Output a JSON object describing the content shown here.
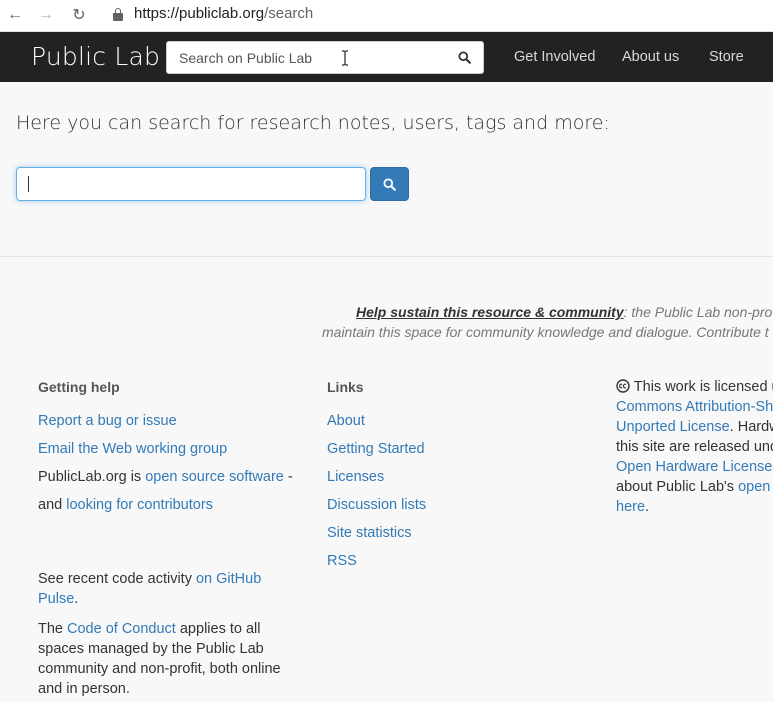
{
  "browser": {
    "url_host": "https://publiclab.org",
    "url_path": "/search",
    "back_icon": "←",
    "forward_icon": "→",
    "reload_icon": "↻"
  },
  "navbar": {
    "brand": "Public Lab",
    "search_placeholder": "Search on Public Lab",
    "links": [
      "Get Involved",
      "About us",
      "Store"
    ]
  },
  "main": {
    "intro": "Here you can search for research notes, users, tags and more:",
    "search_value": ""
  },
  "footer": {
    "sustain_link": "Help sustain this resource & community",
    "sustain_rest": ": the Public Lab non-pro",
    "sustain_line2": "maintain this space for community knowledge and dialogue. Contribute t",
    "getting_help": {
      "title": "Getting help",
      "report_bug": "Report a bug or issue",
      "email_group": "Email the Web working group",
      "oss_prefix": "PublicLab.org is ",
      "oss_link": "open source software",
      "oss_suffix": " -",
      "and_text": "and ",
      "contributors_link": "looking for contributors",
      "recent_prefix": "See recent code activity ",
      "github_link_1": "on GitHub",
      "github_link_2": "Pulse",
      "github_suffix": ".",
      "the_text": "The ",
      "coc_link": "Code of Conduct",
      "coc_rest_1": " applies to all",
      "coc_rest_2": "spaces managed by the Public Lab",
      "coc_rest_3": "community and non-profit, both online",
      "coc_rest_4": "and in person."
    },
    "links": {
      "title": "Links",
      "items": [
        "About",
        "Getting Started",
        "Licenses",
        "Discussion lists",
        "Site statistics",
        "RSS"
      ]
    },
    "license": {
      "cc_icon": "🅭",
      "line1": " This work is licensed u",
      "link1": "Commons Attribution-Sha",
      "link2": "Unported License",
      "line3_rest": ". Hardw",
      "line4": "this site are released und",
      "link3": "Open Hardware License",
      "line5_rest": " ",
      "line6": "about Public Lab's ",
      "link4": "open",
      "link5": "here",
      "end": "."
    }
  },
  "colors": {
    "navbar_bg": "#222222",
    "link": "#337ab7",
    "button_primary": "#337ab7",
    "page_bg": "#f8f8f8"
  }
}
